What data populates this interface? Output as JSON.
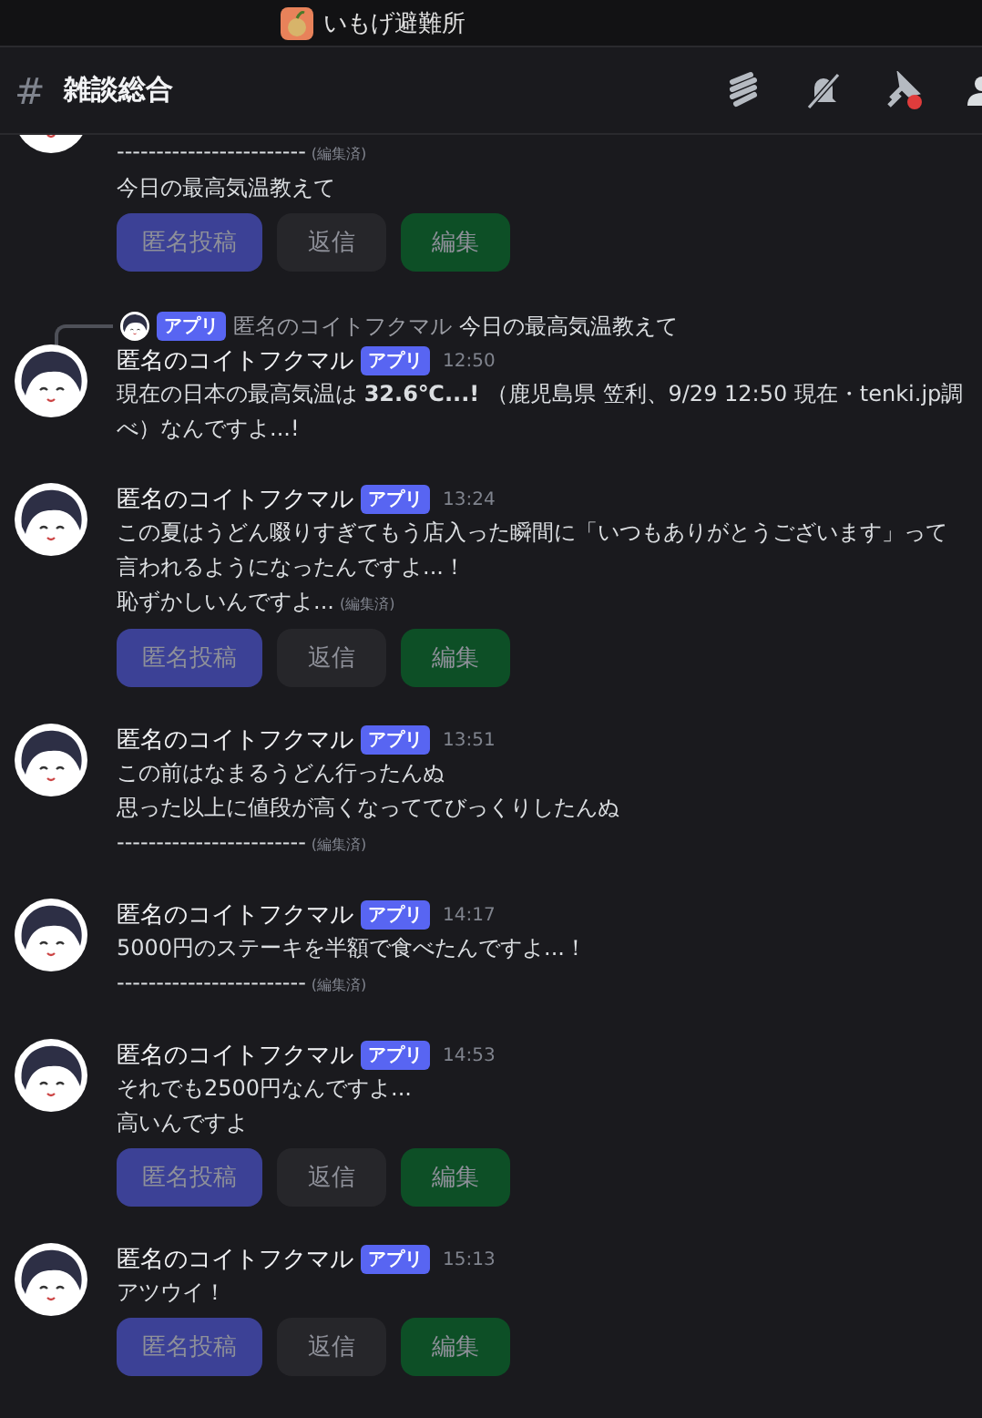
{
  "server": {
    "name": "いもげ避難所"
  },
  "channel": {
    "symbol": "#",
    "name": "雑談総合"
  },
  "messages": [
    {
      "lines": [
        {
          "text": "------------------------",
          "edited": "(編集済)"
        },
        {
          "text": "今日の最高気温教えて"
        }
      ],
      "buttons": [
        {
          "label": "匿名投稿",
          "kind": "primary",
          "disabled": true
        },
        {
          "label": "返信",
          "kind": "secondary",
          "disabled": true
        },
        {
          "label": "編集",
          "kind": "success",
          "disabled": true
        }
      ]
    },
    {
      "reply": {
        "badge": "アプリ",
        "author": "匿名のコイトフクマル",
        "text": "今日の最高気温教えて"
      },
      "author": "匿名のコイトフクマル",
      "badge": "アプリ",
      "time": "12:50",
      "lines": [
        {
          "text": "現在の日本の最高気温は **32.6℃...!** （鹿児島県 笠利、9/29 12:50 現在・tenki.jp調べ）なんですよ...!"
        }
      ]
    },
    {
      "author": "匿名のコイトフクマル",
      "badge": "アプリ",
      "time": "13:24",
      "lines": [
        {
          "text": "この夏はうどん啜りすぎてもう店入った瞬間に「いつもありがとうございます」って言われるようになったんですよ...！"
        },
        {
          "text": "恥ずかしいんですよ...",
          "edited": "(編集済)"
        }
      ],
      "buttons": [
        {
          "label": "匿名投稿",
          "kind": "primary",
          "disabled": true
        },
        {
          "label": "返信",
          "kind": "secondary",
          "disabled": true
        },
        {
          "label": "編集",
          "kind": "success",
          "disabled": true
        }
      ]
    },
    {
      "author": "匿名のコイトフクマル",
      "badge": "アプリ",
      "time": "13:51",
      "lines": [
        {
          "text": "この前はなまるうどん行ったんぬ"
        },
        {
          "text": "思った以上に値段が高くなっててびっくりしたんぬ"
        },
        {
          "text": "------------------------",
          "edited": "(編集済)"
        }
      ]
    },
    {
      "author": "匿名のコイトフクマル",
      "badge": "アプリ",
      "time": "14:17",
      "lines": [
        {
          "text": "5000円のステーキを半額で食べたんですよ...！"
        },
        {
          "text": "------------------------",
          "edited": "(編集済)"
        }
      ]
    },
    {
      "author": "匿名のコイトフクマル",
      "badge": "アプリ",
      "time": "14:53",
      "lines": [
        {
          "text": "それでも2500円なんですよ..."
        },
        {
          "text": "高いんですよ"
        }
      ],
      "buttons": [
        {
          "label": "匿名投稿",
          "kind": "primary",
          "disabled": true
        },
        {
          "label": "返信",
          "kind": "secondary",
          "disabled": true
        },
        {
          "label": "編集",
          "kind": "success",
          "disabled": true
        }
      ]
    },
    {
      "author": "匿名のコイトフクマル",
      "badge": "アプリ",
      "time": "15:13",
      "lines": [
        {
          "text": "アツウイ！"
        }
      ],
      "buttons": [
        {
          "label": "匿名投稿",
          "kind": "primary",
          "disabled": true
        },
        {
          "label": "返信",
          "kind": "secondary",
          "disabled": true
        },
        {
          "label": "編集",
          "kind": "success",
          "disabled": true
        }
      ]
    }
  ]
}
